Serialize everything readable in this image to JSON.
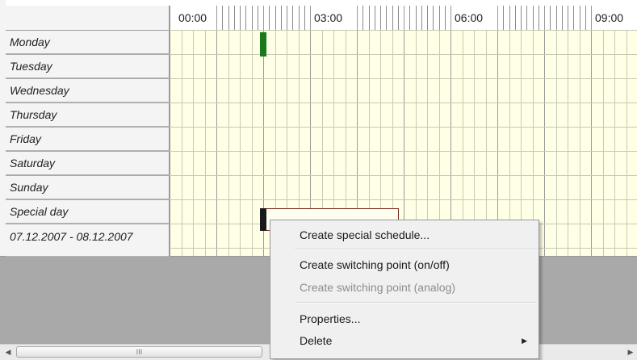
{
  "header": {
    "hours": [
      "00:00",
      "03:00",
      "06:00",
      "09:00"
    ]
  },
  "rows": [
    {
      "label": "Monday"
    },
    {
      "label": "Tuesday"
    },
    {
      "label": "Wednesday"
    },
    {
      "label": "Thursday"
    },
    {
      "label": "Friday"
    },
    {
      "label": "Saturday"
    },
    {
      "label": "Sunday"
    },
    {
      "label": "Special day"
    },
    {
      "label": "07.12.2007 - 08.12.2007"
    }
  ],
  "schedule": {
    "on_segment_color": "#1a7a1a"
  },
  "context_menu": {
    "create_special_schedule": "Create special schedule...",
    "create_switching_on_off": "Create switching point (on/off)",
    "create_switching_analog": "Create switching point (analog)",
    "properties": "Properties...",
    "delete": "Delete",
    "delete_arrow": "▶"
  },
  "scrollbar": {
    "left_arrow": "◀",
    "thumb_grip": "III",
    "right_arrow": "▶"
  }
}
